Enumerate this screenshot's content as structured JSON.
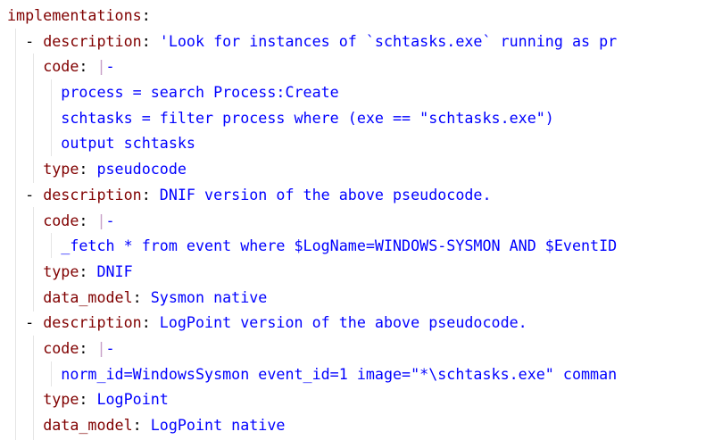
{
  "editor": {
    "lines": [
      [
        {
          "t": "implementations",
          "c": "key"
        },
        {
          "t": ":",
          "c": "punct"
        }
      ],
      [
        {
          "t": "  - ",
          "c": "punct"
        },
        {
          "t": "description",
          "c": "key"
        },
        {
          "t": ": ",
          "c": "punct"
        },
        {
          "t": "'Look for instances of `schtasks.exe` running as pr",
          "c": "val"
        }
      ],
      [
        {
          "t": "    ",
          "c": "punct"
        },
        {
          "t": "code",
          "c": "key"
        },
        {
          "t": ": ",
          "c": "punct"
        },
        {
          "t": "|",
          "c": "lbar"
        },
        {
          "t": "-",
          "c": "val"
        }
      ],
      [
        {
          "t": "      ",
          "c": "punct"
        },
        {
          "t": "process = search Process:Create",
          "c": "val"
        }
      ],
      [
        {
          "t": "      ",
          "c": "punct"
        },
        {
          "t": "schtasks = filter process where (exe == \"schtasks.exe\")",
          "c": "val"
        }
      ],
      [
        {
          "t": "      ",
          "c": "punct"
        },
        {
          "t": "output schtasks",
          "c": "val"
        }
      ],
      [
        {
          "t": "    ",
          "c": "punct"
        },
        {
          "t": "type",
          "c": "key"
        },
        {
          "t": ": ",
          "c": "punct"
        },
        {
          "t": "pseudocode",
          "c": "val"
        }
      ],
      [
        {
          "t": "  - ",
          "c": "punct"
        },
        {
          "t": "description",
          "c": "key"
        },
        {
          "t": ": ",
          "c": "punct"
        },
        {
          "t": "DNIF version of the above pseudocode.",
          "c": "val"
        }
      ],
      [
        {
          "t": "    ",
          "c": "punct"
        },
        {
          "t": "code",
          "c": "key"
        },
        {
          "t": ": ",
          "c": "punct"
        },
        {
          "t": "|",
          "c": "lbar"
        },
        {
          "t": "-",
          "c": "val"
        }
      ],
      [
        {
          "t": "      ",
          "c": "punct"
        },
        {
          "t": "_fetch * from event where $LogName=WINDOWS-SYSMON AND $EventID",
          "c": "val"
        }
      ],
      [
        {
          "t": "    ",
          "c": "punct"
        },
        {
          "t": "type",
          "c": "key"
        },
        {
          "t": ": ",
          "c": "punct"
        },
        {
          "t": "DNIF",
          "c": "val"
        }
      ],
      [
        {
          "t": "    ",
          "c": "punct"
        },
        {
          "t": "data_model",
          "c": "key"
        },
        {
          "t": ": ",
          "c": "punct"
        },
        {
          "t": "Sysmon native",
          "c": "val"
        }
      ],
      [
        {
          "t": "  - ",
          "c": "punct"
        },
        {
          "t": "description",
          "c": "key"
        },
        {
          "t": ": ",
          "c": "punct"
        },
        {
          "t": "LogPoint version of the above pseudocode.",
          "c": "val"
        }
      ],
      [
        {
          "t": "    ",
          "c": "punct"
        },
        {
          "t": "code",
          "c": "key"
        },
        {
          "t": ": ",
          "c": "punct"
        },
        {
          "t": "|",
          "c": "lbar"
        },
        {
          "t": "-",
          "c": "val"
        }
      ],
      [
        {
          "t": "      ",
          "c": "punct"
        },
        {
          "t": "norm_id=WindowsSysmon event_id=1 image=\"*\\schtasks.exe\" comman",
          "c": "val"
        }
      ],
      [
        {
          "t": "    ",
          "c": "punct"
        },
        {
          "t": "type",
          "c": "key"
        },
        {
          "t": ": ",
          "c": "punct"
        },
        {
          "t": "LogPoint",
          "c": "val"
        }
      ],
      [
        {
          "t": "    ",
          "c": "punct"
        },
        {
          "t": "data_model",
          "c": "key"
        },
        {
          "t": ": ",
          "c": "punct"
        },
        {
          "t": "LogPoint native",
          "c": "val"
        }
      ]
    ]
  },
  "colors": {
    "key": "#800000",
    "value": "#0000ff",
    "punctuation": "#000000",
    "block_indicator": "#c8a0c8",
    "indent_guide": "#e5e5e5",
    "background": "#ffffff"
  }
}
